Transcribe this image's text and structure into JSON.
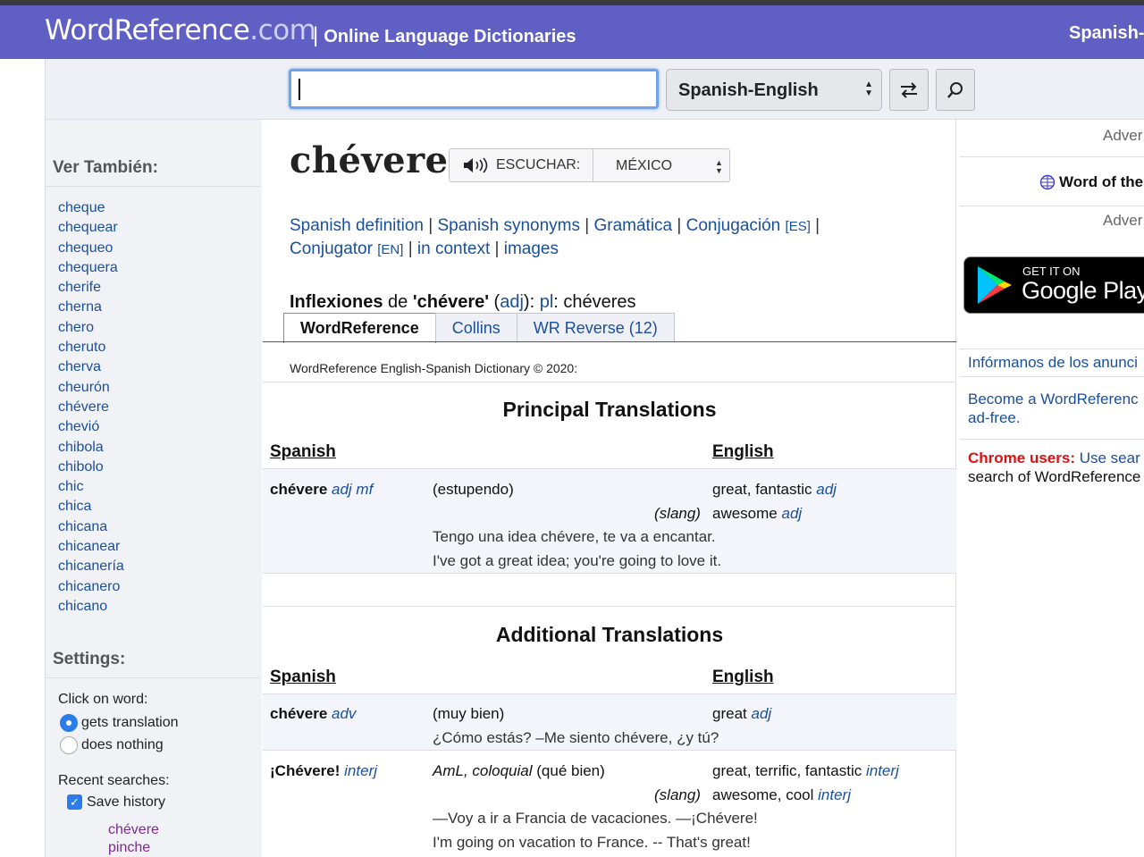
{
  "header": {
    "logo_main": "WordReference",
    "logo_com": ".com",
    "separator": "|",
    "tagline": "Online Language Dictionaries",
    "right_label": "Spanish-"
  },
  "search": {
    "value": "",
    "dictionary_selected": "Spanish-English",
    "icons": {
      "swap": "swap-arrows-icon",
      "search": "magnifier-icon"
    }
  },
  "sidebar": {
    "see_also_title": "Ver También:",
    "see_also": [
      "cheque",
      "chequear",
      "chequeo",
      "chequera",
      "cherife",
      "cherna",
      "chero",
      "cheruto",
      "cherva",
      "cheurón",
      "chévere",
      "chevió",
      "chibola",
      "chibolo",
      "chic",
      "chica",
      "chicana",
      "chicanear",
      "chicanería",
      "chicanero",
      "chicano"
    ],
    "settings_title": "Settings:",
    "click_on_word_label": "Click on word:",
    "opt_translation": "gets translation",
    "opt_nothing": "does nothing",
    "recent_label": "Recent searches:",
    "save_history": "Save history",
    "recent": [
      "chévere",
      "pinche"
    ]
  },
  "entry": {
    "headword": "chévere",
    "listen_label": "ESCUCHAR:",
    "accent_selected": "MÉXICO",
    "links": {
      "spanish_definition": "Spanish definition",
      "spanish_synonyms": "Spanish synonyms",
      "gramatica": "Gramática",
      "conjugacion": "Conjugación",
      "es_tag": "[ES]",
      "conjugator": "Conjugator",
      "en_tag": "[EN]",
      "in_context": "in context",
      "images": "images",
      "sep": "|"
    },
    "inflex": {
      "label": "Inflexiones",
      "de": "de",
      "word": "'chévere'",
      "pos": "adj",
      "pl_label": "pl",
      "plural": "chéveres"
    },
    "tabs": [
      "WordReference",
      "Collins",
      "WR Reverse (12)"
    ],
    "dict_credit": "WordReference English-Spanish Dictionary © 2020:"
  },
  "principal": {
    "title": "Principal Translations",
    "col_spanish": "Spanish",
    "col_english": "English",
    "term": "chévere",
    "term_pos": "adj mf",
    "sense": "(estupendo)",
    "en1": "great, fantastic",
    "en1_pos": "adj",
    "slang_note": "(slang)",
    "en2": "awesome",
    "en2_pos": "adj",
    "ex_es": "Tengo una idea chévere, te va a encantar.",
    "ex_en": "I've got a great idea; you're going to love it."
  },
  "additional": {
    "title": "Additional Translations",
    "col_spanish": "Spanish",
    "col_english": "English",
    "row1": {
      "term": "chévere",
      "term_pos": "adv",
      "sense": "(muy bien)",
      "en": "great",
      "en_pos": "adj",
      "ex_es": "¿Cómo estás? –Me siento chévere, ¿y tú?"
    },
    "row2": {
      "term": "¡Chévere!",
      "term_pos": "interj",
      "sense_italic": "AmL, coloquial",
      "sense": "(qué bien)",
      "en": "great, terrific, fantastic",
      "en_pos": "interj",
      "slang_note": "(slang)",
      "en2": "awesome, cool",
      "en2_pos": "interj",
      "ex_es": "—Voy a ir a Francia de vacaciones. —¡Chévere!",
      "ex_en": "I'm going on vacation to France. -- That's great!"
    }
  },
  "right": {
    "adv1": "Adver",
    "wotd": "Word of the",
    "adv2": "Adver",
    "gp_small": "GET IT ON",
    "gp_big": "Google Play",
    "inform": "Infórmanos de los anunci",
    "become1": "Become a WordReferenc",
    "become2": "ad-free.",
    "chrome_bold": "Chrome users:",
    "chrome_rest": "Use sear",
    "chrome_line2": "search of WordReference"
  },
  "colors": {
    "header": "#5f5fc4",
    "link": "#1a4f9c",
    "visited": "#7b2a90",
    "alert": "#dd1111"
  }
}
